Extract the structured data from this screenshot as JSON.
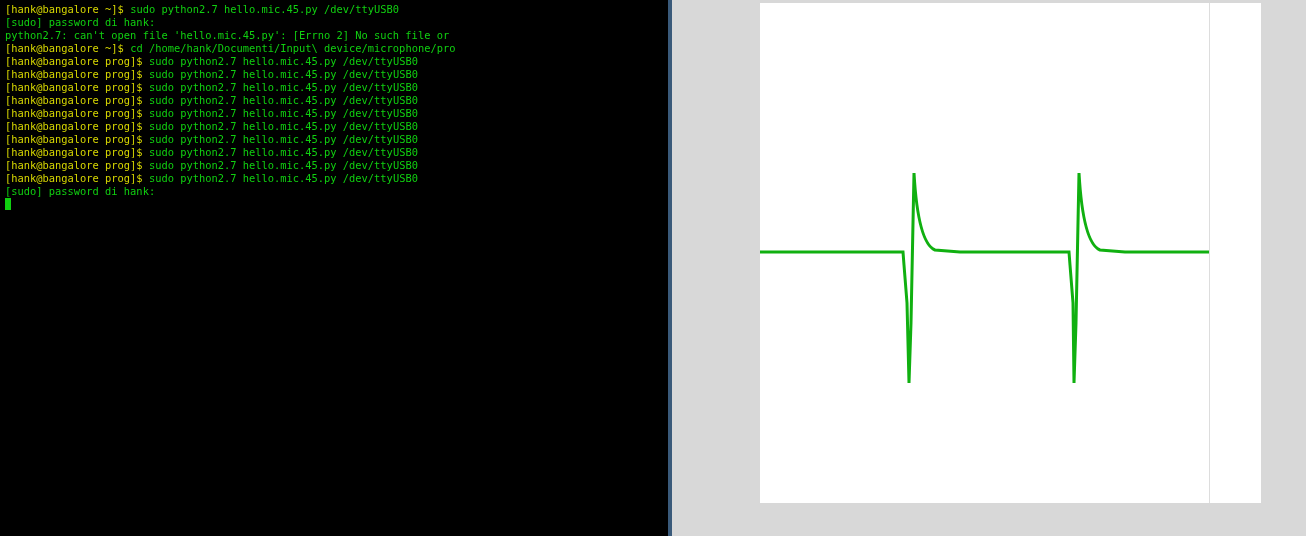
{
  "terminal": {
    "lines": [
      {
        "kind": "prompt",
        "prompt": "[hank@bangalore ~]$",
        "command": "sudo python2.7 hello.mic.45.py /dev/ttyUSB0"
      },
      {
        "kind": "output",
        "text": "[sudo] password di hank:"
      },
      {
        "kind": "output",
        "text": "python2.7: can't open file 'hello.mic.45.py': [Errno 2] No such file or"
      },
      {
        "kind": "prompt",
        "prompt": "[hank@bangalore ~]$",
        "command": "cd /home/hank/Documenti/Input\\ device/microphone/pro"
      },
      {
        "kind": "prompt",
        "prompt": "[hank@bangalore prog]$",
        "command": "sudo python2.7 hello.mic.45.py /dev/ttyUSB0"
      },
      {
        "kind": "prompt",
        "prompt": "[hank@bangalore prog]$",
        "command": "sudo python2.7 hello.mic.45.py /dev/ttyUSB0"
      },
      {
        "kind": "prompt",
        "prompt": "[hank@bangalore prog]$",
        "command": "sudo python2.7 hello.mic.45.py /dev/ttyUSB0"
      },
      {
        "kind": "prompt",
        "prompt": "[hank@bangalore prog]$",
        "command": "sudo python2.7 hello.mic.45.py /dev/ttyUSB0"
      },
      {
        "kind": "prompt",
        "prompt": "[hank@bangalore prog]$",
        "command": "sudo python2.7 hello.mic.45.py /dev/ttyUSB0"
      },
      {
        "kind": "prompt",
        "prompt": "[hank@bangalore prog]$",
        "command": "sudo python2.7 hello.mic.45.py /dev/ttyUSB0"
      },
      {
        "kind": "prompt",
        "prompt": "[hank@bangalore prog]$",
        "command": "sudo python2.7 hello.mic.45.py /dev/ttyUSB0"
      },
      {
        "kind": "prompt",
        "prompt": "[hank@bangalore prog]$",
        "command": "sudo python2.7 hello.mic.45.py /dev/ttyUSB0"
      },
      {
        "kind": "prompt",
        "prompt": "[hank@bangalore prog]$",
        "command": "sudo python2.7 hello.mic.45.py /dev/ttyUSB0"
      },
      {
        "kind": "prompt",
        "prompt": "[hank@bangalore prog]$",
        "command": "sudo python2.7 hello.mic.45.py /dev/ttyUSB0"
      },
      {
        "kind": "output",
        "text": "[sudo] password di hank:"
      }
    ]
  }
}
